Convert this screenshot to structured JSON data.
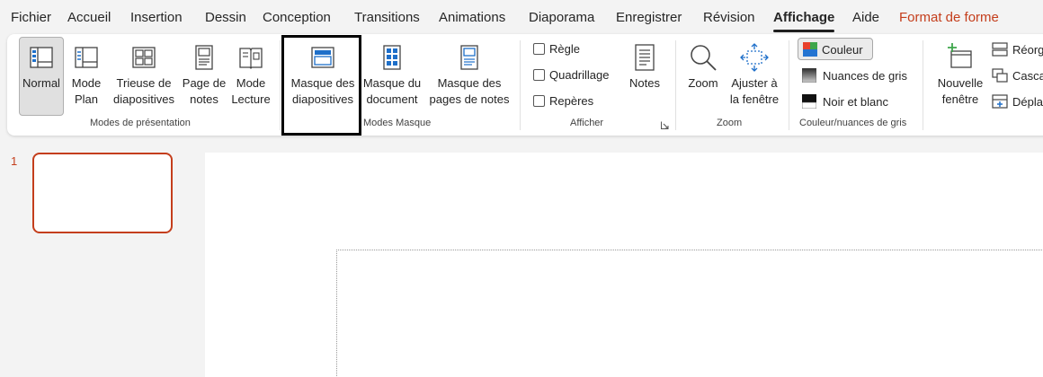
{
  "menu": {
    "tabs": [
      {
        "label": "Fichier"
      },
      {
        "label": "Accueil"
      },
      {
        "label": "Insertion"
      },
      {
        "label": "Dessin"
      },
      {
        "label": "Conception"
      },
      {
        "label": "Transitions"
      },
      {
        "label": "Animations"
      },
      {
        "label": "Diaporama"
      },
      {
        "label": "Enregistrer"
      },
      {
        "label": "Révision"
      },
      {
        "label": "Affichage"
      },
      {
        "label": "Aide"
      },
      {
        "label": "Format de forme"
      }
    ],
    "active_tab": "Affichage"
  },
  "ribbon": {
    "presentation_views": {
      "group_label": "Modes de présentation",
      "normal": {
        "line1": "Normal"
      },
      "plan": {
        "line1": "Mode",
        "line2": "Plan"
      },
      "sorter": {
        "line1": "Trieuse de",
        "line2": "diapositives"
      },
      "notes_page": {
        "line1": "Page de",
        "line2": "notes"
      },
      "reading": {
        "line1": "Mode",
        "line2": "Lecture"
      }
    },
    "master_views": {
      "group_label": "Modes Masque",
      "slide_master": {
        "line1": "Masque des",
        "line2": "diapositives"
      },
      "handout_master": {
        "line1": "Masque du",
        "line2": "document"
      },
      "notes_master": {
        "line1": "Masque des",
        "line2": "pages de notes"
      }
    },
    "show": {
      "group_label": "Afficher",
      "ruler": "Règle",
      "gridlines": "Quadrillage",
      "guides": "Repères",
      "notes": "Notes"
    },
    "zoom": {
      "group_label": "Zoom",
      "zoom": "Zoom",
      "fit": {
        "line1": "Ajuster à",
        "line2": "la fenêtre"
      }
    },
    "color": {
      "group_label": "Couleur/nuances de gris",
      "color": "Couleur",
      "grayscale": "Nuances de gris",
      "bw": "Noir et blanc"
    },
    "window": {
      "new_window": {
        "line1": "Nouvelle",
        "line2": "fenêtre"
      },
      "arrange": "Réorg",
      "cascade": "Casca",
      "move": "Dépla"
    }
  },
  "thumbnails": {
    "first_number": "1"
  },
  "colors": {
    "accent": "#c43e1c",
    "active_tab": "#1f1f1f"
  }
}
